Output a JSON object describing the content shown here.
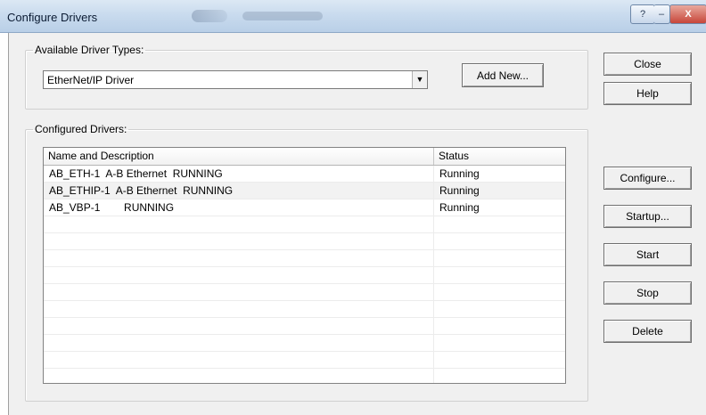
{
  "window": {
    "title": "Configure Drivers",
    "help_glyph": "?",
    "minimize_glyph": "–",
    "close_glyph": "X"
  },
  "available": {
    "legend": "Available Driver Types:",
    "selected": "EtherNet/IP Driver",
    "add_new": "Add New..."
  },
  "configured": {
    "legend": "Configured Drivers:",
    "columns": [
      "Name and Description",
      "Status"
    ],
    "rows": [
      {
        "name": "AB_ETH-1  A-B Ethernet  RUNNING",
        "status": "Running"
      },
      {
        "name": "AB_ETHIP-1  A-B Ethernet  RUNNING",
        "status": "Running"
      },
      {
        "name": "AB_VBP-1        RUNNING",
        "status": "Running"
      },
      {
        "name": "",
        "status": ""
      },
      {
        "name": "",
        "status": ""
      },
      {
        "name": "",
        "status": ""
      },
      {
        "name": "",
        "status": ""
      },
      {
        "name": "",
        "status": ""
      },
      {
        "name": "",
        "status": ""
      },
      {
        "name": "",
        "status": ""
      },
      {
        "name": "",
        "status": ""
      },
      {
        "name": "",
        "status": ""
      },
      {
        "name": "",
        "status": ""
      }
    ]
  },
  "buttons": {
    "close": "Close",
    "help": "Help",
    "configure": "Configure...",
    "startup": "Startup...",
    "start": "Start",
    "stop": "Stop",
    "delete": "Delete"
  },
  "icons": {
    "dropdown": "chevron-down-icon"
  },
  "colors": {
    "dialog_bg": "#f0f0f0",
    "titlebar": "#c9dbee",
    "row_alt": "#f2f2f2"
  }
}
